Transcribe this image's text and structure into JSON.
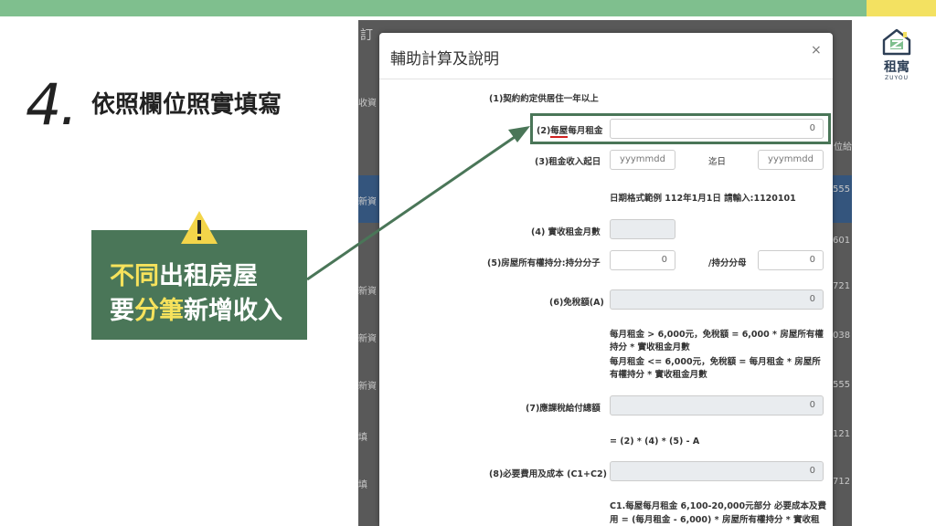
{
  "slide": {
    "step_number": "4.",
    "step_title": "依照欄位照實填寫",
    "warning": {
      "line1_part1": "不同",
      "line1_part2": "出租房屋",
      "line2_part1": "要",
      "line2_part2": "分筆",
      "line2_part3": "新增收入",
      "icon": "warning-icon"
    },
    "logo": {
      "name": "租寓",
      "sub": "ZUYOU",
      "icon": "house-logo-icon"
    },
    "colors": {
      "green_bar": "#7fbf8e",
      "yellow_bar": "#f3e161",
      "box_green": "#4a7658",
      "highlight_yellow": "#f6e25c"
    }
  },
  "modal": {
    "title": "輔助計算及說明",
    "close_label": "×",
    "rows": {
      "r1_label": "(1)契約約定供居住一年以上",
      "r2_prefix": "(2)",
      "r2_underlined": "每屋",
      "r2_suffix": "每月租金",
      "r2_value": "0",
      "r3_label": "(3)租金收入起日",
      "r3_placeholder_start": "yyymmdd",
      "r3_to_label": "迄日",
      "r3_placeholder_end": "yyymmdd",
      "date_example": "日期格式範例 112年1月1日 請輸入:1120101",
      "r4_label": "(4) 實收租金月數",
      "r5_label": "(5)房屋所有權持分:持分分子",
      "r5_numerator": "0",
      "r5_denom_label": "/持分分母",
      "r5_denominator": "0",
      "r6_label": "(6)免稅額(A)",
      "r6_value": "0",
      "r6_note1": "每月租金 > 6,000元，免稅額 = 6,000 * 房屋所有權",
      "r6_note2": "持分 * 實收租金月數",
      "r6_note3": "每月租金 <= 6,000元，免稅額 = 每月租金 * 房屋所",
      "r6_note4": "有權持分 * 實收租金月數",
      "r7_label": "(7)應課稅給付總額",
      "r7_value": "0",
      "r7_formula": "= (2) * (4) * (5) - A",
      "r8_label": "(8)必要費用及成本 (C1+C2)",
      "r8_value": "0",
      "c1_note1": "C1.每屋每月租金 6,100-20,000元部分 必要成本及費",
      "c1_note2": "用 = (每月租金 - 6,000) * 房屋所有權持分 * 實收租"
    }
  },
  "backdrop": {
    "items": [
      "訂",
      "收資",
      "新資",
      "新資",
      "新資",
      "新資",
      "填",
      "填"
    ],
    "numbers": [
      "555",
      "601",
      "721",
      "038",
      "555",
      "121",
      "712"
    ],
    "right_label": "位給"
  }
}
